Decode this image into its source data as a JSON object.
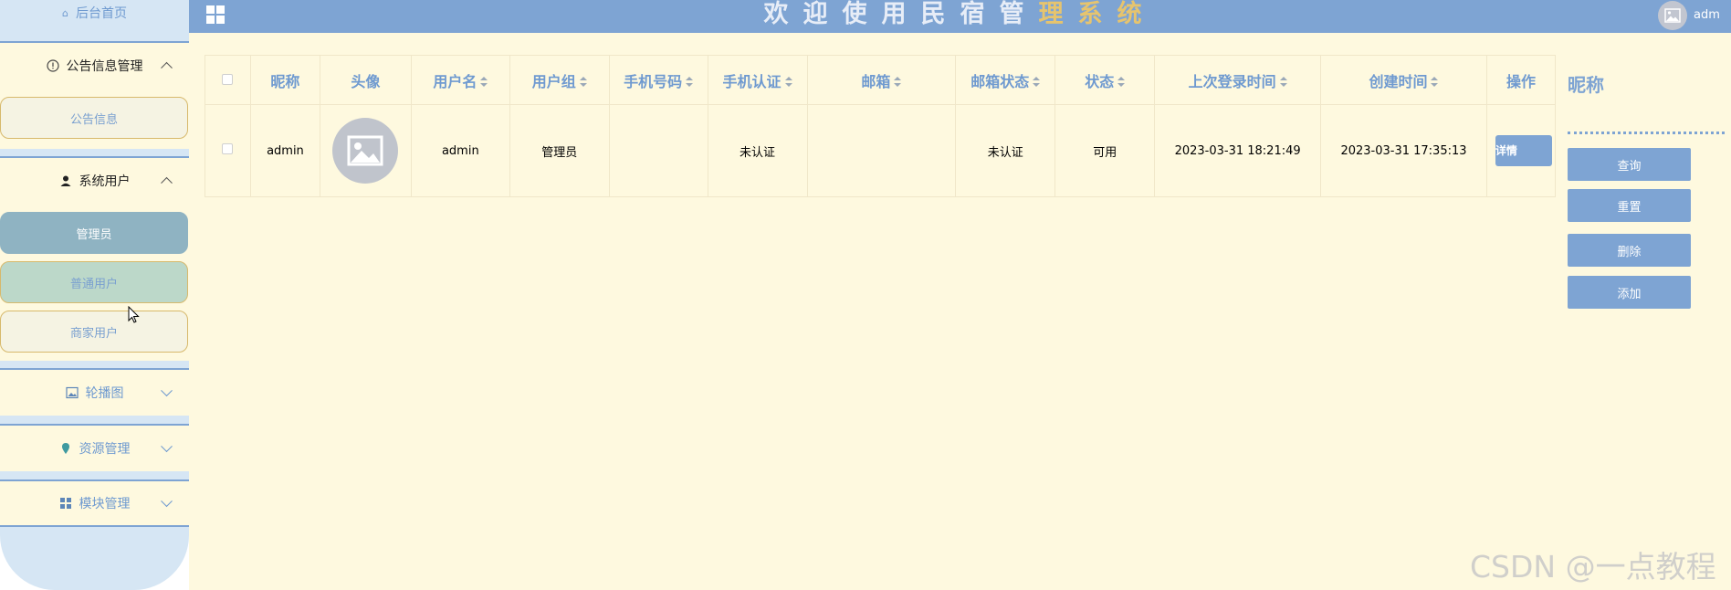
{
  "sidebar": {
    "home_label": "后台首页",
    "groups": [
      {
        "label": "公告信息管理",
        "icon": "info-icon",
        "expanded": true,
        "items": [
          "公告信息"
        ]
      },
      {
        "label": "系统用户",
        "icon": "user-icon",
        "expanded": true,
        "items": [
          "管理员",
          "普通用户",
          "商家用户"
        ]
      },
      {
        "label": "轮播图",
        "icon": "image-icon",
        "expanded": false
      },
      {
        "label": "资源管理",
        "icon": "location-icon",
        "expanded": false
      },
      {
        "label": "模块管理",
        "icon": "grid-icon",
        "expanded": false
      }
    ],
    "active_item": "管理员",
    "hover_item": "普通用户"
  },
  "header": {
    "title_main": "欢迎使用民宿管",
    "title_gold": "理系统",
    "user": "adm",
    "menu_icon": "grid-icon"
  },
  "table": {
    "columns": [
      "昵称",
      "头像",
      "用户名",
      "用户组",
      "手机号码",
      "手机认证",
      "邮箱",
      "邮箱状态",
      "状态",
      "上次登录时间",
      "创建时间",
      "操作"
    ],
    "rows": [
      {
        "nickname": "admin",
        "avatar": "image-placeholder-icon",
        "username": "admin",
        "group": "管理员",
        "phone": "",
        "phone_verified": "未认证",
        "email": "",
        "email_status": "未认证",
        "status": "可用",
        "last_login": "2023-03-31 18:21:49",
        "created": "2023-03-31 17:35:13",
        "action": "详情"
      }
    ]
  },
  "right_panel": {
    "title": "昵称",
    "buttons": [
      "查询",
      "重置",
      "删除",
      "添加"
    ]
  },
  "watermark": "CSDN @一点教程",
  "colors": {
    "header": "#7ea4d3",
    "sidebar": "#d6e6f4",
    "content_bg": "#fef9df",
    "accent_gold": "#e6c46e",
    "active_item": "#8fb3c2"
  }
}
